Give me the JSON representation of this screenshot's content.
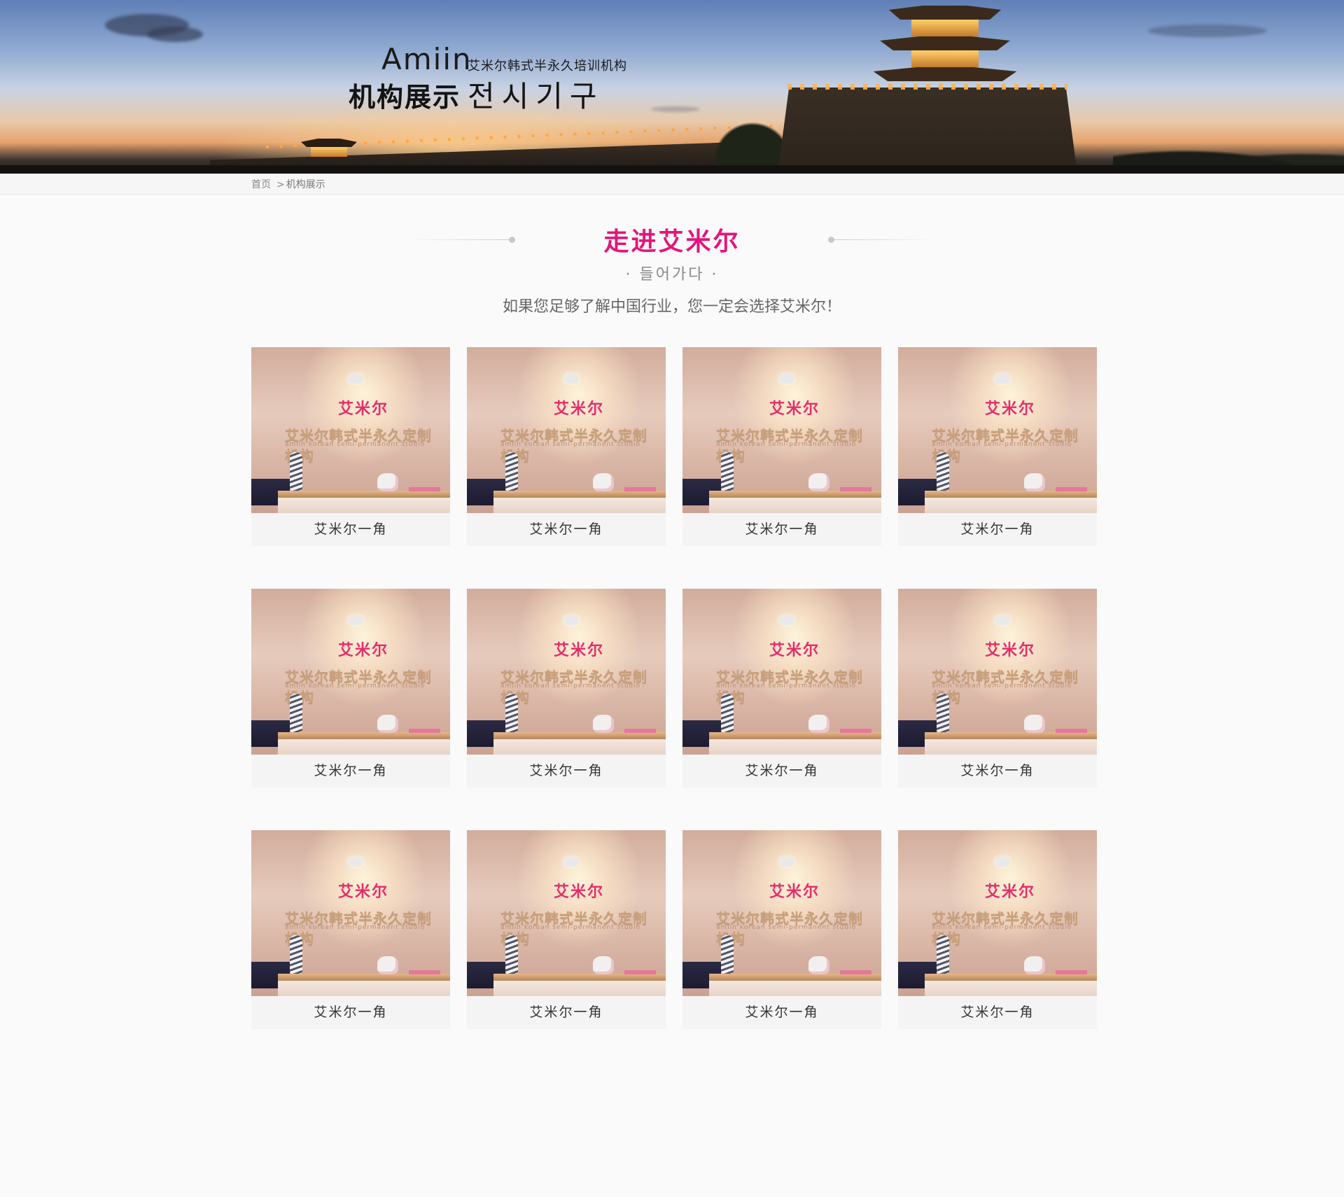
{
  "banner": {
    "brand": "Amiin",
    "brand_sub": "艾米尔韩式半永久培训机构",
    "title_cn": "机构展示",
    "title_kr": "전시기구"
  },
  "breadcrumb": {
    "home": "首页",
    "separator": ">",
    "current": "机构展示"
  },
  "section": {
    "title": "走进艾米尔",
    "subtitle": "· 들어가다 ·",
    "description": "如果您足够了解中国行业，您一定会选择艾米尔！"
  },
  "gallery": {
    "items": [
      {
        "caption": "艾米尔一角",
        "logo_top": "艾米尔",
        "logo_main": "艾米尔韩式半永久定制机构",
        "logo_sub": "amiin korean semi-permanent studio"
      },
      {
        "caption": "艾米尔一角",
        "logo_top": "艾米尔",
        "logo_main": "艾米尔韩式半永久定制机构",
        "logo_sub": "amiin korean semi-permanent studio"
      },
      {
        "caption": "艾米尔一角",
        "logo_top": "艾米尔",
        "logo_main": "艾米尔韩式半永久定制机构",
        "logo_sub": "amiin korean semi-permanent studio"
      },
      {
        "caption": "艾米尔一角",
        "logo_top": "艾米尔",
        "logo_main": "艾米尔韩式半永久定制机构",
        "logo_sub": "amiin korean semi-permanent studio"
      },
      {
        "caption": "艾米尔一角",
        "logo_top": "艾米尔",
        "logo_main": "艾米尔韩式半永久定制机构",
        "logo_sub": "amiin korean semi-permanent studio"
      },
      {
        "caption": "艾米尔一角",
        "logo_top": "艾米尔",
        "logo_main": "艾米尔韩式半永久定制机构",
        "logo_sub": "amiin korean semi-permanent studio"
      },
      {
        "caption": "艾米尔一角",
        "logo_top": "艾米尔",
        "logo_main": "艾米尔韩式半永久定制机构",
        "logo_sub": "amiin korean semi-permanent studio"
      },
      {
        "caption": "艾米尔一角",
        "logo_top": "艾米尔",
        "logo_main": "艾米尔韩式半永久定制机构",
        "logo_sub": "amiin korean semi-permanent studio"
      },
      {
        "caption": "艾米尔一角",
        "logo_top": "艾米尔",
        "logo_main": "艾米尔韩式半永久定制机构",
        "logo_sub": "amiin korean semi-permanent studio"
      },
      {
        "caption": "艾米尔一角",
        "logo_top": "艾米尔",
        "logo_main": "艾米尔韩式半永久定制机构",
        "logo_sub": "amiin korean semi-permanent studio"
      },
      {
        "caption": "艾米尔一角",
        "logo_top": "艾米尔",
        "logo_main": "艾米尔韩式半永久定制机构",
        "logo_sub": "amiin korean semi-permanent studio"
      },
      {
        "caption": "艾米尔一角",
        "logo_top": "艾米尔",
        "logo_main": "艾米尔韩式半永久定制机构",
        "logo_sub": "amiin korean semi-permanent studio"
      }
    ]
  },
  "colors": {
    "accent": "#e4147c",
    "page_bg": "#fafafa",
    "caption_bg": "#f4f4f4"
  }
}
